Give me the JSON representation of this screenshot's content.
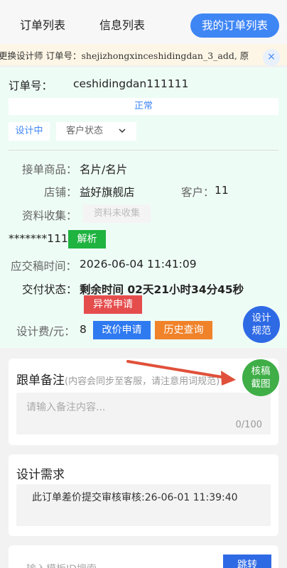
{
  "tabs": [
    {
      "label": "订单列表"
    },
    {
      "label": "信息列表"
    },
    {
      "label": "我的订单列表"
    }
  ],
  "marquee": {
    "text": "更换设计师  订单号：shejizhongxinceshidingdan_3_add, 原"
  },
  "close_glyph": "×",
  "order": {
    "label": "订单号：",
    "number": "ceshidingdan111111",
    "status": "正常",
    "design_state": "设计中",
    "customer_state_placeholder": "客户状态",
    "product_label": "接单商品：",
    "product_value": "名片/名片",
    "shop_label": "店铺：",
    "shop_value": "益好旗舰店",
    "customer_label": "客户：",
    "customer_value": "11",
    "collect_label": "资料收集：",
    "collect_button": "资料未收集",
    "masked_text": "*******111",
    "parse_button": "解析",
    "due_label": "应交稿时间：",
    "due_value": "2026-06-04 11:41:09",
    "delivery_label": "交付状态：",
    "delivery_value": "剩余时间 02天21小时34分45秒",
    "abnormal_button": "异常申请",
    "fee_label": "设计费/元：",
    "fee_value": "8",
    "price_change_button": "改价申请",
    "history_button": "历史查询"
  },
  "fab": {
    "spec_line1": "设计",
    "spec_line2": "规范",
    "review_line1": "核稿",
    "review_line2": "截图"
  },
  "notes": {
    "title": "跟单备注",
    "hint": "(内容会同步至客服，请注意用词规范)",
    "placeholder": "请输入备注内容...",
    "counter": "0/100"
  },
  "requirements": {
    "title": "设计需求",
    "text": "此订单差价提交审核审核:26-06-01 11:39:40"
  },
  "template_search": {
    "placeholder": "输入模板ID搜索",
    "button": "跳转"
  },
  "colors": {
    "accent": "#3f86f5",
    "panel_bg": "#eefcf6",
    "marquee_bg": "#fdf6e6",
    "green": "#1fb340",
    "red": "#e54d4d",
    "orange": "#f0822a",
    "arrow": "#e0503a"
  }
}
